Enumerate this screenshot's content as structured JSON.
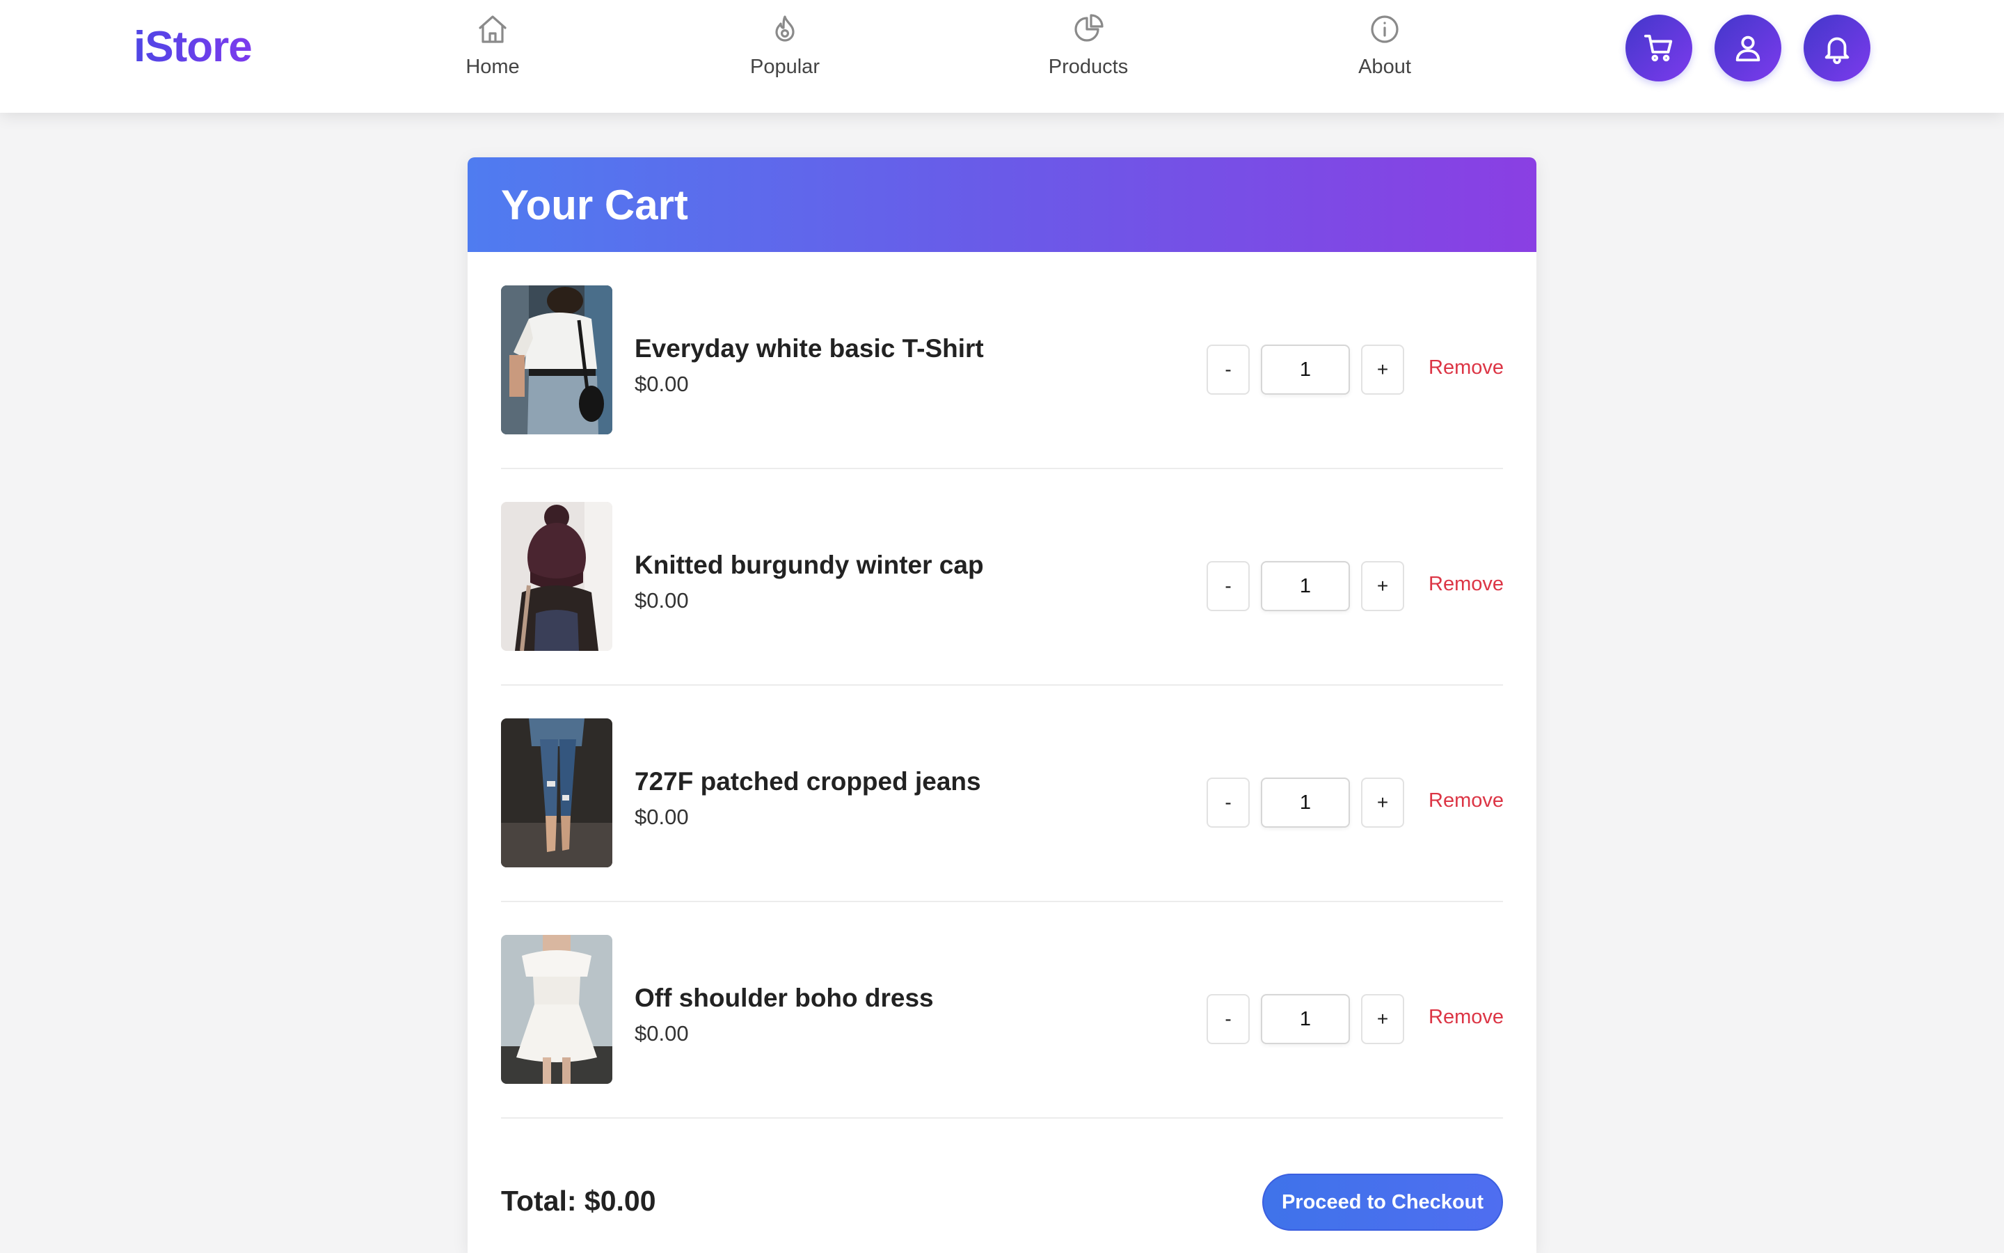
{
  "app": {
    "logo": "iStore"
  },
  "nav": [
    {
      "label": "Home",
      "icon": "home-icon"
    },
    {
      "label": "Popular",
      "icon": "flame-icon"
    },
    {
      "label": "Products",
      "icon": "pie-chart-icon"
    },
    {
      "label": "About",
      "icon": "info-icon"
    }
  ],
  "actions": [
    {
      "icon": "cart-icon"
    },
    {
      "icon": "user-icon"
    },
    {
      "icon": "bell-icon"
    }
  ],
  "cart": {
    "title": "Your Cart",
    "items": [
      {
        "name": "Everyday white basic T-Shirt",
        "price": "$0.00",
        "quantity": "1",
        "decrement": "-",
        "increment": "+",
        "remove": "Remove",
        "image": "white-tshirt-photo"
      },
      {
        "name": "Knitted burgundy winter cap",
        "price": "$0.00",
        "quantity": "1",
        "decrement": "-",
        "increment": "+",
        "remove": "Remove",
        "image": "burgundy-cap-photo"
      },
      {
        "name": "727F patched cropped jeans",
        "price": "$0.00",
        "quantity": "1",
        "decrement": "-",
        "increment": "+",
        "remove": "Remove",
        "image": "cropped-jeans-photo"
      },
      {
        "name": "Off shoulder boho dress",
        "price": "$0.00",
        "quantity": "1",
        "decrement": "-",
        "increment": "+",
        "remove": "Remove",
        "image": "boho-dress-photo"
      }
    ],
    "total_label": "Total: $0.00",
    "checkout_label": "Proceed to Checkout"
  },
  "colors": {
    "accent": "#4f46e5",
    "header_gradient_start": "#4f7cf0",
    "header_gradient_end": "#8a3fe3",
    "remove": "#dc3545"
  }
}
